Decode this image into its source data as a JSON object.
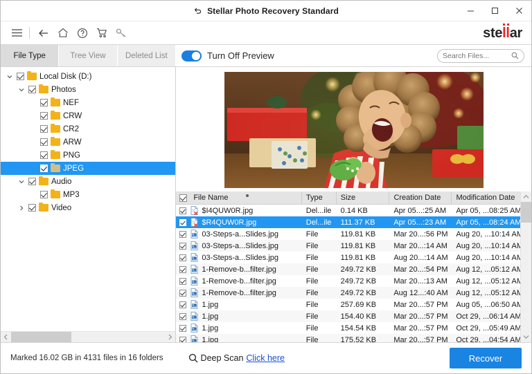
{
  "window": {
    "title": "Stellar Photo Recovery Standard",
    "title_icon": "restore-icon",
    "minimize_label": "Minimize",
    "maximize_label": "Maximize",
    "close_label": "Close"
  },
  "toolbar": {
    "items": [
      {
        "name": "menu-icon",
        "label": "Menu"
      },
      {
        "name": "back-icon",
        "label": "Back"
      },
      {
        "name": "home-icon",
        "label": "Home"
      },
      {
        "name": "help-icon",
        "label": "Help"
      },
      {
        "name": "cart-icon",
        "label": "Buy"
      },
      {
        "name": "key-icon",
        "label": "Activate"
      }
    ],
    "logo": {
      "pre": "ste",
      "mid": "ll",
      "post": "ar"
    }
  },
  "tabs": [
    {
      "label": "File Type",
      "active": true
    },
    {
      "label": "Tree View",
      "active": false
    },
    {
      "label": "Deleted List",
      "active": false
    }
  ],
  "preview": {
    "toggle_on": true,
    "toggle_label": "Turn Off Preview",
    "image_alt": "Laughing child in striped pajamas holding a toy in front of a Christmas tree with gifts"
  },
  "search": {
    "placeholder": "Search Files...",
    "value": "",
    "icon": "search-icon"
  },
  "tree": [
    {
      "label": "Local Disk (D:)",
      "depth": 0,
      "checked": true,
      "expanded": true,
      "selected": false
    },
    {
      "label": "Photos",
      "depth": 1,
      "checked": true,
      "expanded": true,
      "selected": false
    },
    {
      "label": "NEF",
      "depth": 2,
      "checked": true,
      "expanded": null,
      "selected": false
    },
    {
      "label": "CRW",
      "depth": 2,
      "checked": true,
      "expanded": null,
      "selected": false
    },
    {
      "label": "CR2",
      "depth": 2,
      "checked": true,
      "expanded": null,
      "selected": false
    },
    {
      "label": "ARW",
      "depth": 2,
      "checked": true,
      "expanded": null,
      "selected": false
    },
    {
      "label": "PNG",
      "depth": 2,
      "checked": true,
      "expanded": null,
      "selected": false
    },
    {
      "label": "JPEG",
      "depth": 2,
      "checked": true,
      "expanded": null,
      "selected": true
    },
    {
      "label": "Audio",
      "depth": 1,
      "checked": true,
      "expanded": true,
      "selected": false
    },
    {
      "label": "MP3",
      "depth": 2,
      "checked": true,
      "expanded": null,
      "selected": false
    },
    {
      "label": "Video",
      "depth": 1,
      "checked": true,
      "expanded": false,
      "selected": false
    }
  ],
  "table": {
    "header_checked": true,
    "sorted_column": "File Name",
    "columns": [
      "File Name",
      "Type",
      "Size",
      "Creation Date",
      "Modification Date"
    ],
    "rows": [
      {
        "checked": true,
        "icon": "deleted-file-icon",
        "name": "$I4QUW0R.jpg",
        "type": "Del...ile",
        "size": "0.14 KB",
        "created": "Apr 05...:25 AM",
        "modified": "Apr 05, ...08:25 AM",
        "selected": false
      },
      {
        "checked": true,
        "icon": "deleted-file-icon",
        "name": "$R4QUW0R.jpg",
        "type": "Del...ile",
        "size": "111.37 KB",
        "created": "Apr 05...:23 AM",
        "modified": "Apr 05, ...08:24 AM",
        "selected": true
      },
      {
        "checked": true,
        "icon": "image-file-icon",
        "name": "03-Steps-a...Slides.jpg",
        "type": "File",
        "size": "119.81 KB",
        "created": "Mar 20...:56 PM",
        "modified": "Aug 20, ...10:14 AM",
        "selected": false
      },
      {
        "checked": true,
        "icon": "image-file-icon",
        "name": "03-Steps-a...Slides.jpg",
        "type": "File",
        "size": "119.81 KB",
        "created": "Mar 20...:14 AM",
        "modified": "Aug 20, ...10:14 AM",
        "selected": false
      },
      {
        "checked": true,
        "icon": "image-file-icon",
        "name": "03-Steps-a...Slides.jpg",
        "type": "File",
        "size": "119.81 KB",
        "created": "Aug 20...:14 AM",
        "modified": "Aug 20, ...10:14 AM",
        "selected": false
      },
      {
        "checked": true,
        "icon": "image-file-icon",
        "name": "1-Remove-b...filter.jpg",
        "type": "File",
        "size": "249.72 KB",
        "created": "Mar 20...:54 PM",
        "modified": "Aug 12, ...05:12 AM",
        "selected": false
      },
      {
        "checked": true,
        "icon": "image-file-icon",
        "name": "1-Remove-b...filter.jpg",
        "type": "File",
        "size": "249.72 KB",
        "created": "Mar 20...:13 AM",
        "modified": "Aug 12, ...05:12 AM",
        "selected": false
      },
      {
        "checked": true,
        "icon": "image-file-icon",
        "name": "1-Remove-b...filter.jpg",
        "type": "File",
        "size": "249.72 KB",
        "created": "Aug 12...:40 AM",
        "modified": "Aug 12, ...05:12 AM",
        "selected": false
      },
      {
        "checked": true,
        "icon": "image-file-icon",
        "name": "1.jpg",
        "type": "File",
        "size": "257.69 KB",
        "created": "Mar 20...:57 PM",
        "modified": "Aug 05, ...06:50 AM",
        "selected": false
      },
      {
        "checked": true,
        "icon": "image-file-icon",
        "name": "1.jpg",
        "type": "File",
        "size": "154.40 KB",
        "created": "Mar 20...:57 PM",
        "modified": "Oct 29, ...06:14 AM",
        "selected": false
      },
      {
        "checked": true,
        "icon": "image-file-icon",
        "name": "1.jpg",
        "type": "File",
        "size": "154.54 KB",
        "created": "Mar 20...:57 PM",
        "modified": "Oct 29, ...05:49 AM",
        "selected": false
      },
      {
        "checked": true,
        "icon": "image-file-icon",
        "name": "1.jpg",
        "type": "File",
        "size": "175.52 KB",
        "created": "Mar 20...:57 PM",
        "modified": "Oct 29, ...04:54 AM",
        "selected": false
      }
    ]
  },
  "statusbar": {
    "marked_text": "Marked 16.02 GB in 4131 files in 16 folders",
    "deep_scan_label": "Deep Scan",
    "deep_scan_link": "Click here",
    "deep_scan_icon": "search-icon",
    "recover_label": "Recover"
  },
  "colors": {
    "accent": "#1a84e2",
    "selection": "#2196f3",
    "folder": "#f3b318",
    "logo_red": "#e8242a",
    "link": "#1a4fd6"
  }
}
